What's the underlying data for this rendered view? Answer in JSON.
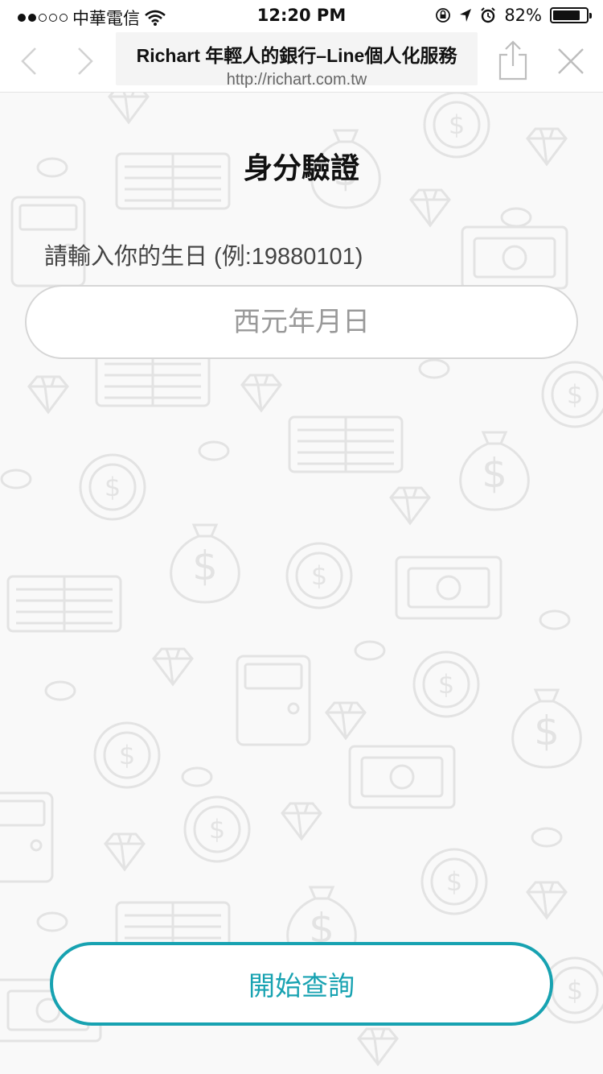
{
  "status_bar": {
    "carrier": "中華電信",
    "time": "12:20 PM",
    "battery": "82%",
    "battery_level": 0.82,
    "icons": [
      "signal-dots",
      "wifi-icon",
      "lock-rotation-icon",
      "location-arrow-icon",
      "alarm-icon",
      "battery-icon"
    ]
  },
  "nav": {
    "title": "Richart 年輕人的銀行–Line個人化服務",
    "url": "http://richart.com.tw",
    "icons": [
      "back-icon",
      "forward-icon",
      "share-icon",
      "close-icon"
    ]
  },
  "page": {
    "title": "身分驗證",
    "birthday_label": "請輸入你的生日 (例:19880101)",
    "birthday_placeholder": "西元年月日",
    "submit_label": "開始查詢"
  },
  "colors": {
    "accent": "#17a2b1",
    "background": "#f9f9f9",
    "pattern": "#e6e6e6"
  }
}
